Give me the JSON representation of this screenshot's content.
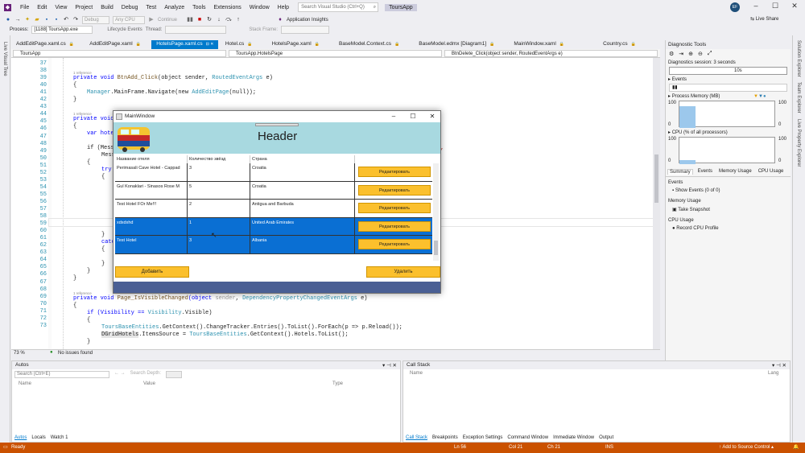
{
  "menu": [
    "File",
    "Edit",
    "View",
    "Project",
    "Build",
    "Debug",
    "Test",
    "Analyze",
    "Tools",
    "Extensions",
    "Window",
    "Help"
  ],
  "search_placeholder": "Search Visual Studio (Ctrl+Q)",
  "app_title": "ToursApp",
  "avatar_initials": "EF",
  "toolbar": {
    "config": "Debug",
    "platform": "Any CPU",
    "continue": "Continue",
    "app_insights": "Application Insights",
    "live_share": "Live Share"
  },
  "toolbar2": {
    "process_label": "Process:",
    "process_value": "[1188] ToursApp.exe",
    "lifecycle": "Lifecycle Events",
    "thread_label": "Thread:",
    "stack_frame": "Stack Frame:"
  },
  "left_strip": "Live Visual Tree",
  "right_strip": [
    "Solution Explorer",
    "Team Explorer",
    "Live Property Explorer"
  ],
  "tabs": [
    {
      "label": "AddEditPage.xaml.cs",
      "active": false
    },
    {
      "label": "AddEditPage.xaml",
      "active": false
    },
    {
      "label": "HotelsPage.xaml.cs",
      "active": true
    },
    {
      "label": "Hotel.cs",
      "active": false
    },
    {
      "label": "HotelsPage.xaml",
      "active": false
    },
    {
      "label": "BaseModel.Context.cs",
      "active": false
    },
    {
      "label": "BaseModel.edmx [Diagram1]",
      "active": false
    },
    {
      "label": "MainWindow.xaml",
      "active": false
    },
    {
      "label": "Country.cs",
      "active": false
    }
  ],
  "nav": {
    "project": "ToursApp",
    "class": "ToursApp.HotelsPage",
    "member": "BtnDelete_Click(object sender, RoutedEventArgs e)"
  },
  "lines": [
    "37",
    "38",
    "39",
    "40",
    "41",
    "42",
    "43",
    "44",
    "45",
    "46",
    "47",
    "48",
    "49",
    "50",
    "51",
    "52",
    "53",
    "54",
    "55",
    "56",
    "57",
    "58",
    "59",
    "60",
    "61",
    "62",
    "63",
    "64",
    "65",
    "66",
    "67",
    "68",
    "69",
    "70",
    "71",
    "72",
    "73"
  ],
  "refs": "1 reference",
  "code": {
    "l38a": "private void ",
    "l38b": "BtnAdd_Click",
    "l38c": "(object sender, ",
    "l38d": "RoutedEventArgs",
    "l38e": " e)",
    "l39": "{",
    "l40a": "Manager",
    "l40b": ".MainFrame.Navigate(new ",
    "l40c": "AddEditPage",
    "l40d": "(null));",
    "l41": "}",
    "l44": "private void",
    "l45": "{",
    "l46": "var hote",
    "l48": "if (Mess",
    "l48b": "\",",
    "l49": "Mess",
    "l50": "{",
    "l51": "try",
    "l52": "{",
    "l58": "}",
    "l59": "catc",
    "l60": "{",
    "l62": "}",
    "l63": "}",
    "l64": "}",
    "l66a": "private void ",
    "l66b": "Page_IsVisibleChanged",
    "l66c": "(object ",
    "l66d": "sender",
    "l66e": ", ",
    "l66f": "DependencyPropertyChangedEventArgs",
    "l66g": " e)",
    "l67": "{",
    "l68a": "if (Visibility == ",
    "l68b": "Visibility",
    "l68c": ".Visible)",
    "l69": "{",
    "l70a": "ToursBaseEntities",
    "l70b": ".GetContext().ChangeTracker.Entries().ToList().ForEach(p => p.Reload());",
    "l71a": "DGridHotels",
    "l71b": ".ItemsSource = ",
    "l71c": "ToursBaseEntities",
    "l71d": ".GetContext().Hotels.ToList();",
    "l72": "}",
    "l73": "}"
  },
  "editor_status": {
    "zoom": "73 %",
    "issues": "No issues found"
  },
  "diag": {
    "title": "Diagnostic Tools",
    "session": "Diagnostics session: 3 seconds",
    "tick": "10s",
    "events": "Events",
    "mem": "Process Memory (MB)",
    "mem_max": "100",
    "mem_min": "0",
    "cpu": "CPU (% of all processors)",
    "cpu_max": "100",
    "cpu_min": "0",
    "tabs": [
      "Summary",
      "Events",
      "Memory Usage",
      "CPU Usage"
    ],
    "s_events": "Events",
    "show_events": "Show Events (0 of 0)",
    "s_mem": "Memory Usage",
    "snapshot": "Take Snapshot",
    "s_cpu": "CPU Usage",
    "record": "Record CPU Profile"
  },
  "autos": {
    "title": "Autos",
    "search": "Search (Ctrl+E)",
    "depth": "Search Depth:",
    "cols": [
      "Name",
      "Value",
      "Type"
    ],
    "tabs": [
      "Autos",
      "Locals",
      "Watch 1"
    ]
  },
  "callstack": {
    "title": "Call Stack",
    "cols": [
      "Name",
      "Lang"
    ],
    "tabs": [
      "Call Stack",
      "Breakpoints",
      "Exception Settings",
      "Command Window",
      "Immediate Window",
      "Output"
    ]
  },
  "status": {
    "ready": "Ready",
    "ln": "Ln 56",
    "col": "Col 21",
    "ch": "Ch 21",
    "ins": "INS",
    "source": "Add to Source Control"
  },
  "wpf": {
    "title": "MainWindow",
    "header": "Header",
    "columns": [
      "Название отеля",
      "Количество звёзд",
      "Страна"
    ],
    "rows": [
      {
        "name": "Perimasali Cave Hotel - Cappad",
        "stars": "3",
        "country": "Croatia",
        "selected": false
      },
      {
        "name": "Gul Konaklari - Sinasos Rose M",
        "stars": "5",
        "country": "Croatia",
        "selected": false
      },
      {
        "name": "Test Hotel FOr Me!!!",
        "stars": "2",
        "country": "Antigua and Barbuda",
        "selected": false
      },
      {
        "name": "xdxdxhd",
        "stars": "1",
        "country": "United Arab Emirates",
        "selected": true
      },
      {
        "name": "Test Hotel",
        "stars": "3",
        "country": "Albania",
        "selected": true
      }
    ],
    "edit_label": "Редактировать",
    "add_label": "Добавить",
    "delete_label": "Удалить"
  }
}
